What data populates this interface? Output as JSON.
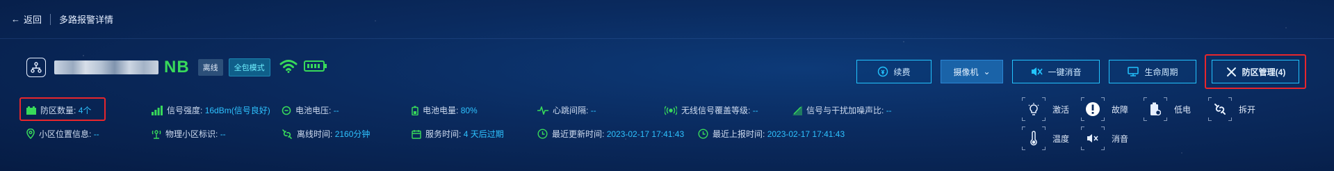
{
  "topbar": {
    "back_label": "返回",
    "page_title": "多路报警详情"
  },
  "device": {
    "model_suffix": "NB",
    "status_tag": "离线",
    "mode_tag": "全包模式"
  },
  "actions": {
    "renew": "续费",
    "camera": "摄像机",
    "mute_all": "一键消音",
    "lifecycle": "生命周期",
    "zone_manage": "防区管理(4)"
  },
  "info": {
    "zone_count": {
      "label": "防区数量:",
      "value": "4个"
    },
    "signal": {
      "label": "信号强度:",
      "value": "16dBm(信号良好)"
    },
    "battery_voltage": {
      "label": "电池电压:",
      "value": "--"
    },
    "battery_level": {
      "label": "电池电量:",
      "value": "80%"
    },
    "heartbeat": {
      "label": "心跳间隔:",
      "value": "--"
    },
    "coverage": {
      "label": "无线信号覆盖等级:",
      "value": "--"
    },
    "sinr": {
      "label": "信号与干扰加噪声比:",
      "value": "--"
    },
    "cell_location": {
      "label": "小区位置信息:",
      "value": "--"
    },
    "pci": {
      "label": "物理小区标识:",
      "value": "--"
    },
    "offline_time": {
      "label": "离线时间:",
      "value": "2160分钟"
    },
    "service_time": {
      "label": "服务时间:",
      "value": "4 天后过期"
    },
    "last_update": {
      "label": "最近更新时间:",
      "value": "2023-02-17 17:41:43"
    },
    "last_report": {
      "label": "最近上报时间:",
      "value": "2023-02-17 17:41:43"
    }
  },
  "status_panel": {
    "activate": "激活",
    "fault": "故障",
    "low_battery": "低电",
    "tamper": "拆开",
    "temperature": "温度",
    "muted": "消音"
  },
  "colors": {
    "accent": "#2ec2ff",
    "green": "#38d95a",
    "highlight_red": "#e8262c"
  }
}
